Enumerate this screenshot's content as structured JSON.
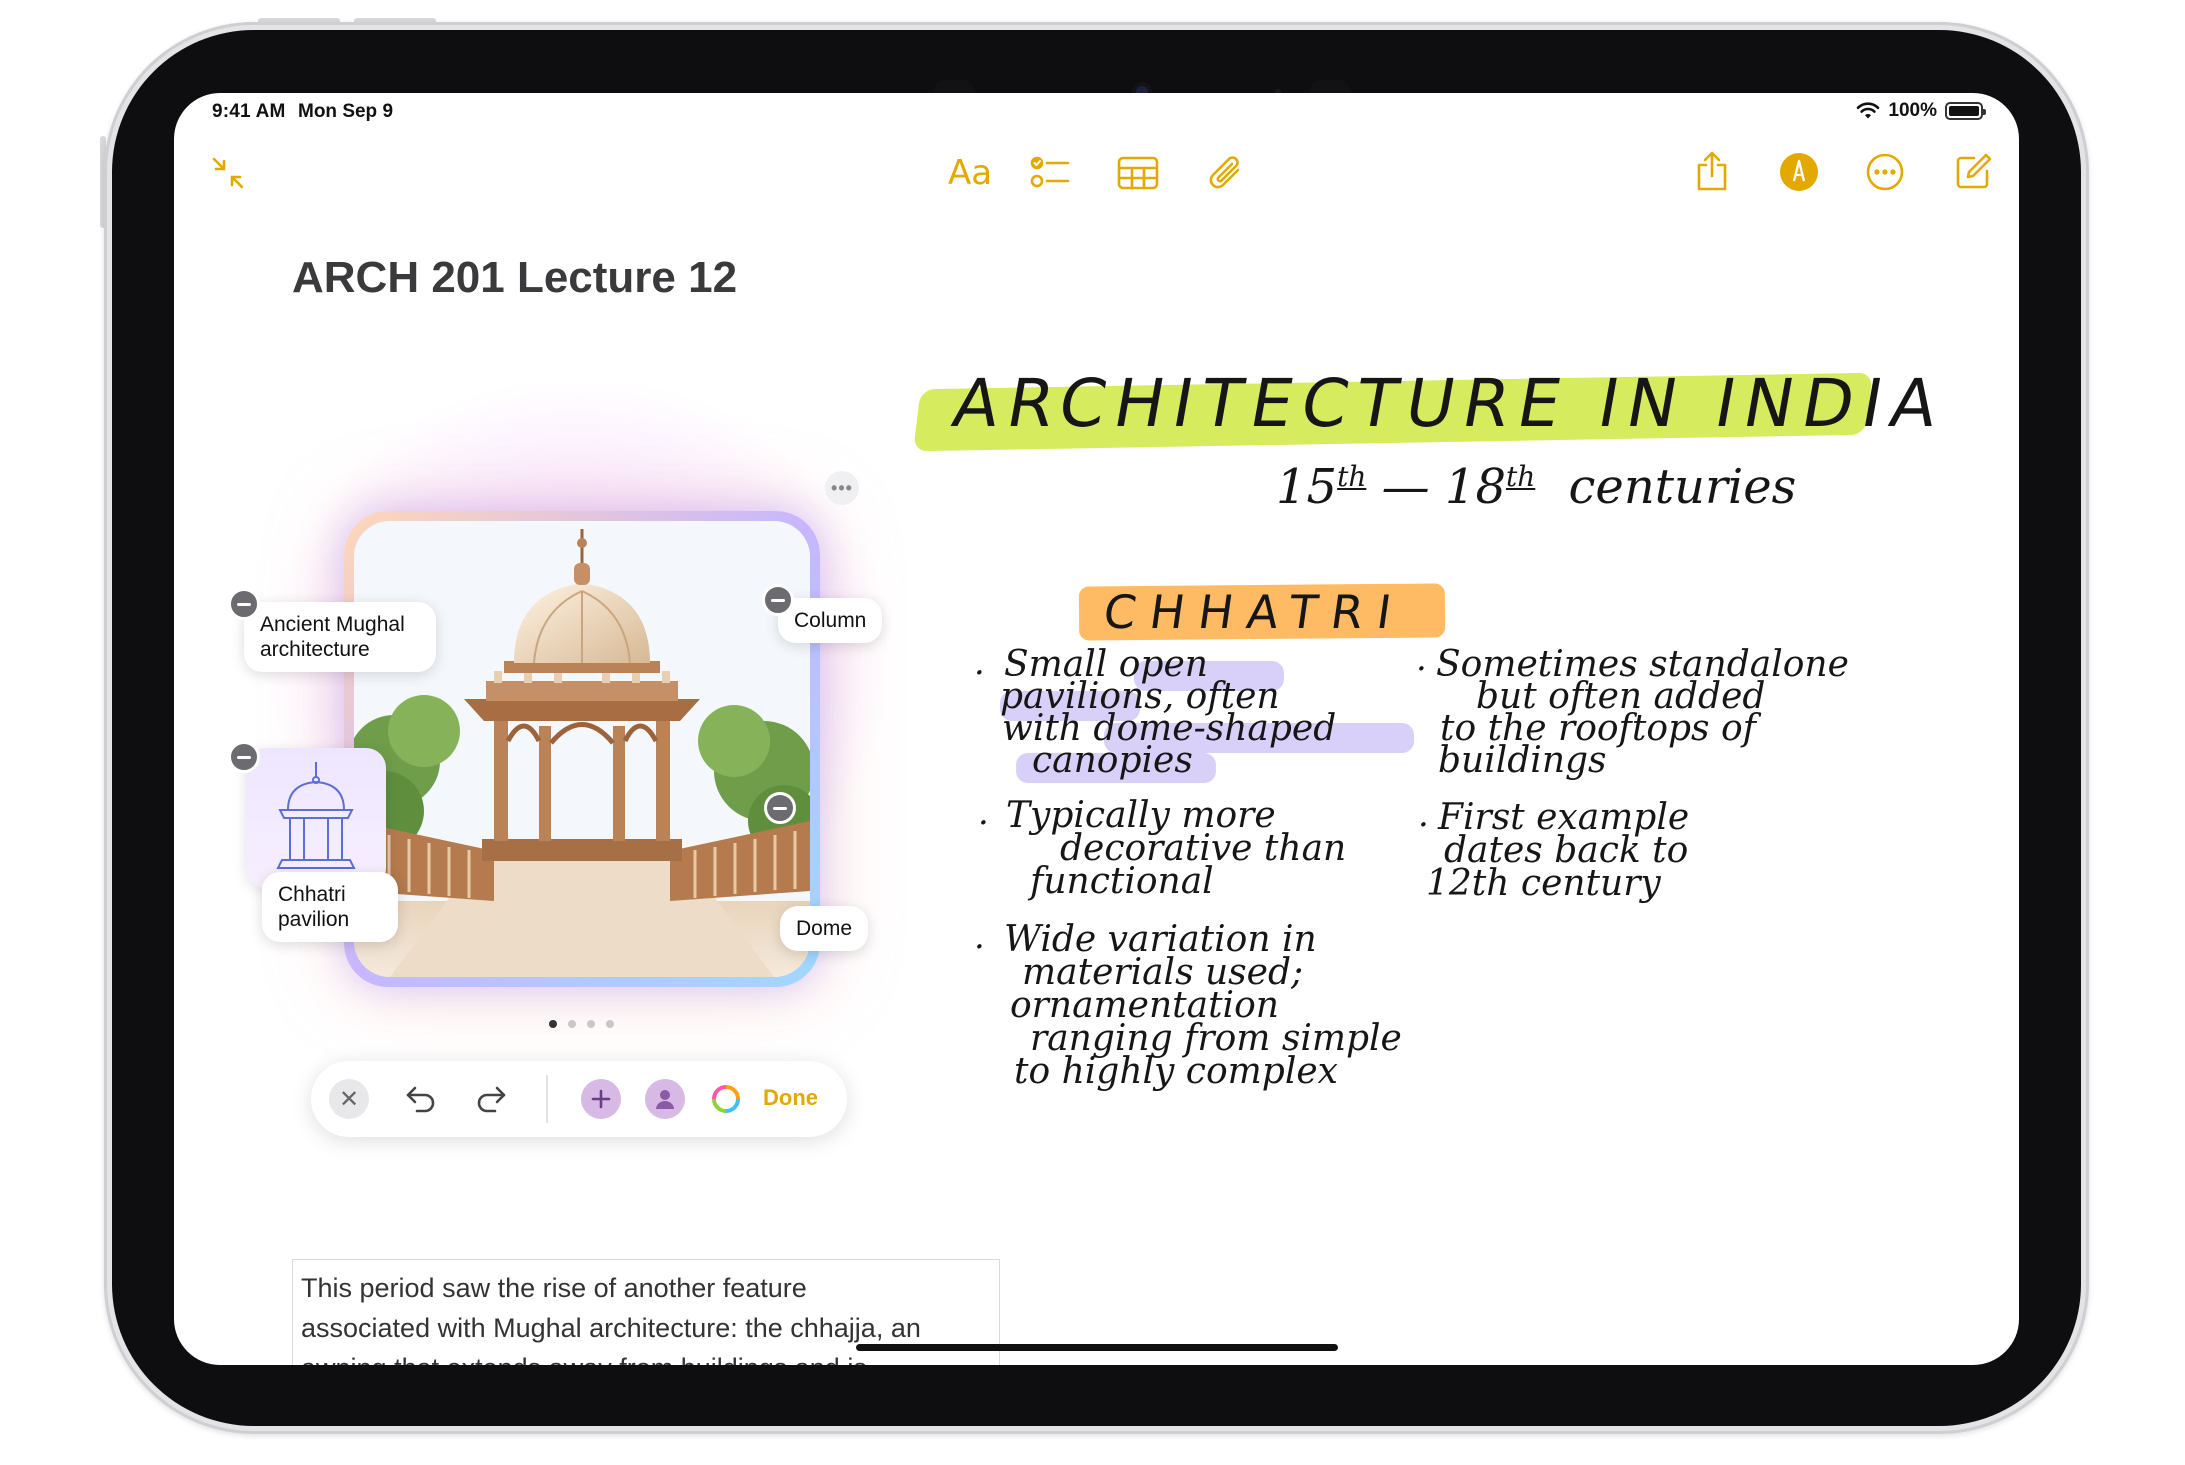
{
  "status_bar": {
    "time": "9:41 AM",
    "date": "Mon Sep 9",
    "battery": "100%",
    "battery_level": 1.0
  },
  "toolbar": {
    "collapse_icon": "collapse-arrows-icon",
    "text_format_label": "Aa",
    "icons": [
      "checklist-icon",
      "table-icon",
      "paperclip-icon",
      "share-icon",
      "markup-pen-icon",
      "ellipsis-circle-icon",
      "compose-icon"
    ],
    "accent_color": "#E3A900"
  },
  "note": {
    "title": "ARCH 201 Lecture 12",
    "body_lines": [
      "This period saw the rise of another feature",
      "associated with Mughal architecture: the chhajja, an",
      "awning that extends away from buildings and is"
    ]
  },
  "image_playground": {
    "concepts": [
      "Ancient Mughal architecture",
      "Column",
      "Dome",
      "Chhatri pavilion"
    ],
    "page_count": 4,
    "active_page": 0,
    "done_label": "Done"
  },
  "handwriting": {
    "heading": "ARCHITECTURE IN INDIA",
    "subheading_start": "15",
    "subheading_start_sup": "th",
    "subheading_dash": "—",
    "subheading_end": "18",
    "subheading_end_sup": "th",
    "subheading_word": "centuries",
    "section": "CHHATRI",
    "bullets_left": [
      [
        "Small open",
        "pavilions, often",
        "with dome-shaped",
        "canopies"
      ],
      [
        "Typically more",
        "decorative than",
        "functional"
      ],
      [
        "Wide variation in",
        "materials used;",
        "ornamentation",
        "ranging from simple",
        "to highly complex"
      ]
    ],
    "bullets_right": [
      [
        "Sometimes standalone",
        "but often added",
        "to the rooftops of",
        "buildings"
      ],
      [
        "First example",
        "dates back to",
        "12th century"
      ]
    ]
  }
}
